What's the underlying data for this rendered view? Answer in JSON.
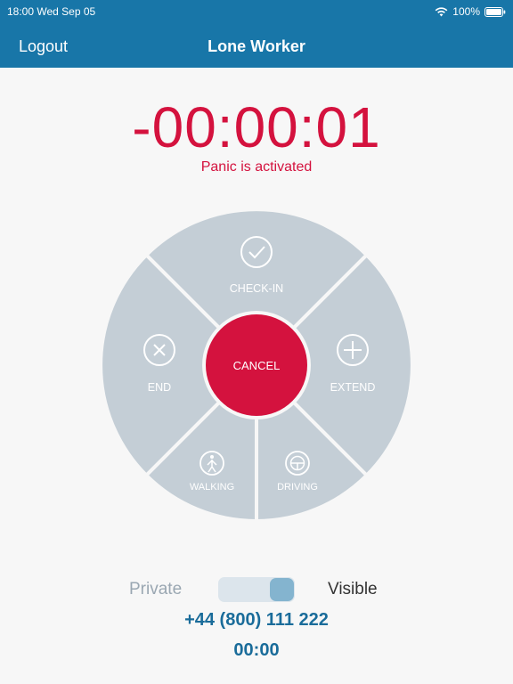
{
  "status_bar": {
    "time": "18:00",
    "date": "Wed Sep 05",
    "battery": "100%"
  },
  "nav": {
    "logout": "Logout",
    "title": "Lone Worker"
  },
  "timer": {
    "value": "-00:00:01",
    "status": "Panic is activated"
  },
  "wheel": {
    "check_in": "CHECK-IN",
    "end": "END",
    "extend": "EXTEND",
    "walking": "WALKING",
    "driving": "DRIVING",
    "cancel": "CANCEL"
  },
  "visibility": {
    "private": "Private",
    "visible": "Visible",
    "is_visible": true
  },
  "phone": "+44 (800) 111 222",
  "counter": "00:00",
  "colors": {
    "header": "#1876a8",
    "accent_red": "#d4123e",
    "segment": "#c4ced6",
    "link_blue": "#1a6c9a"
  }
}
